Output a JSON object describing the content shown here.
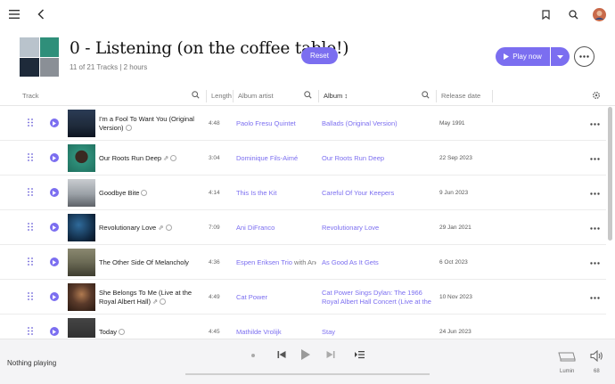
{
  "playlist": {
    "title": "0 - Listening (on the coffee table!)",
    "subtitle": "11 of 21 Tracks | 2 hours",
    "reset_label": "Reset",
    "play_label": "Play now"
  },
  "columns": {
    "track": "Track",
    "length": "Length",
    "album_artist": "Album artist",
    "album": "Album",
    "album_sort": "↕",
    "release_date": "Release date"
  },
  "tracks": [
    {
      "title": "I'm a Fool To Want You (Original Version)",
      "length": "4:48",
      "artist": "Paolo Fresu Quintet",
      "artist_extra": "",
      "album": "Ballads (Original Version)",
      "date": "May 1991",
      "thumb": "#1e2a3a"
    },
    {
      "title": "Our Roots Run Deep",
      "length": "3:04",
      "artist": "Dominique Fils-Aimé",
      "artist_extra": "",
      "album": "Our Roots Run Deep",
      "date": "22 Sep 2023",
      "thumb": "#2f8f7a"
    },
    {
      "title": "Goodbye Bite",
      "length": "4:14",
      "artist": "This Is the Kit",
      "artist_extra": "",
      "album": "Careful Of Your Keepers",
      "date": "9 Jun 2023",
      "thumb": "#8a8f96"
    },
    {
      "title": "Revolutionary Love",
      "length": "7:09",
      "artist": "Ani DiFranco",
      "artist_extra": "",
      "album": "Revolutionary Love",
      "date": "29 Jan 2021",
      "thumb": "#0f2740"
    },
    {
      "title": "The Other Side Of Melancholy",
      "length": "4:36",
      "artist": "Espen Eriksen Trio",
      "artist_extra": " with Andy",
      "album": "As Good As It Gets",
      "date": "6 Oct 2023",
      "thumb": "#6b6a55"
    },
    {
      "title": "She Belongs To Me (Live at the Royal Albert Hall)",
      "length": "4:49",
      "artist": "Cat Power",
      "artist_extra": "",
      "album": "Cat Power Sings Dylan: The 1966 Royal Albert Hall Concert (Live at the",
      "date": "10 Nov 2023",
      "thumb": "#5a3a2a"
    },
    {
      "title": "Today",
      "length": "4:45",
      "artist": "Mathilde Vrolijk",
      "artist_extra": "",
      "album": "Stay",
      "date": "24 Jun 2023",
      "thumb": "#2a2a2a"
    }
  ],
  "player": {
    "status": "Nothing playing",
    "device": "Lumin",
    "volume": "68"
  }
}
